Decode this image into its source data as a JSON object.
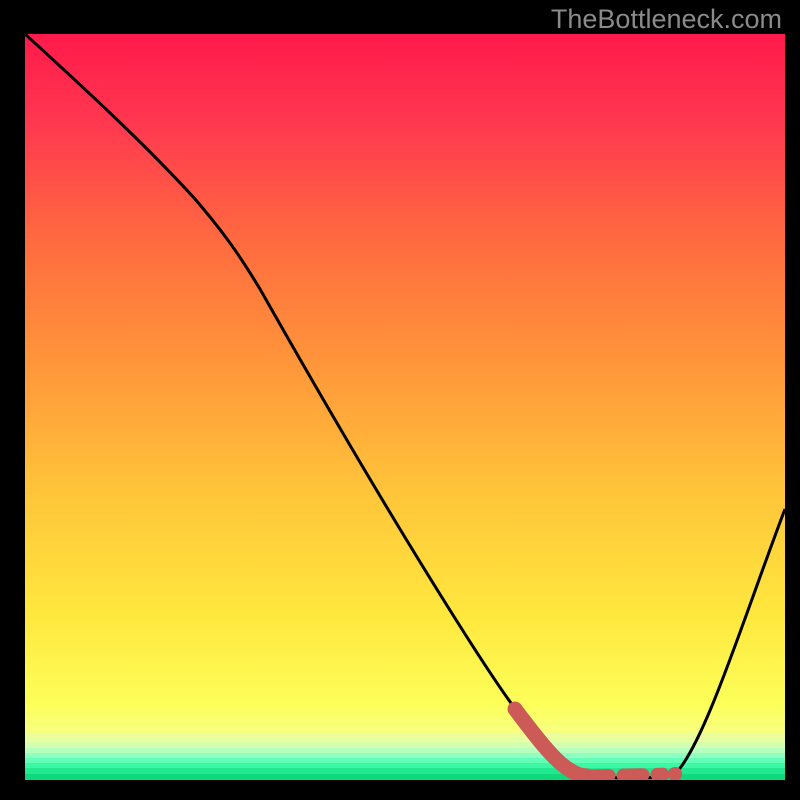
{
  "watermark": "TheBottleneck.com",
  "colors": {
    "curve": "#000000",
    "highlight": "#cc5a57",
    "gradient_top": "#ff1a4b",
    "gradient_bottom": "#0fd97b"
  },
  "chart_data": {
    "type": "line",
    "title": "",
    "xlabel": "",
    "ylabel": "",
    "xlim": [
      0,
      100
    ],
    "ylim": [
      0,
      100
    ],
    "series": [
      {
        "name": "bottleneck-curve",
        "x": [
          0,
          8,
          16,
          22,
          28,
          35,
          45,
          55,
          63,
          70,
          75,
          79,
          82,
          86,
          90,
          95,
          100
        ],
        "y": [
          100,
          92,
          85,
          78,
          70,
          60,
          44,
          28,
          17,
          9,
          4,
          1,
          0,
          0,
          2,
          14,
          36
        ]
      },
      {
        "name": "recommended-range-solid",
        "x": [
          64,
          67,
          70,
          73,
          74
        ],
        "y": [
          10,
          7,
          4,
          2,
          1
        ]
      },
      {
        "name": "recommended-range-dashed",
        "x": [
          74,
          78,
          82,
          86
        ],
        "y": [
          1,
          0.5,
          0.5,
          0.5
        ]
      }
    ],
    "annotations": []
  }
}
